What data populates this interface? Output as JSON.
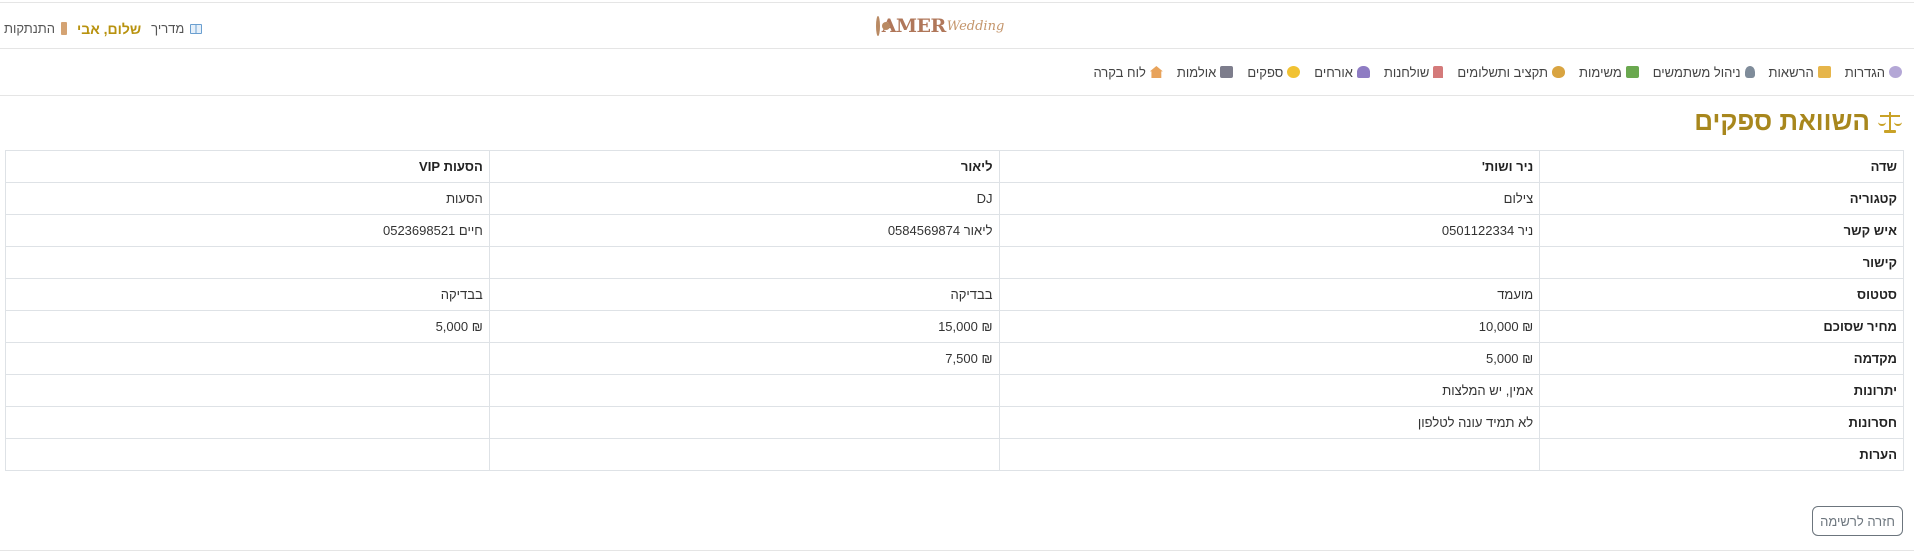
{
  "header": {
    "logo_text": "AMER",
    "logo_script": "Wedding",
    "logout_label": "התנתקות",
    "greeting": "שלום, אבי",
    "guide_label": "מדריך"
  },
  "nav": {
    "items": [
      {
        "label": "לוח בקרה",
        "icon": "home-icon"
      },
      {
        "label": "אולמות",
        "icon": "hall-icon"
      },
      {
        "label": "ספקים",
        "icon": "handshake-icon"
      },
      {
        "label": "אורחים",
        "icon": "people-icon"
      },
      {
        "label": "שולחנות",
        "icon": "chair-icon"
      },
      {
        "label": "תקציב ותשלומים",
        "icon": "money-bag-icon"
      },
      {
        "label": "משימות",
        "icon": "checkmark-icon"
      },
      {
        "label": "ניהול משתמשים",
        "icon": "user-icon"
      },
      {
        "label": "הרשאות",
        "icon": "lock-icon"
      },
      {
        "label": "הגדרות",
        "icon": "gear-icon"
      }
    ]
  },
  "page": {
    "title": "השוואת ספקים",
    "back_button": "חזרה לרשימה"
  },
  "table": {
    "headers": [
      "שדה",
      "ניר ושות'",
      "ליאור",
      "הסעות VIP"
    ],
    "rows": [
      [
        "קטגוריה",
        "צילום",
        "DJ",
        "הסעות"
      ],
      [
        "איש קשר",
        "ניר 0501122334",
        "ליאור 0584569874",
        "חיים 0523698521"
      ],
      [
        "קישור",
        "",
        "",
        ""
      ],
      [
        "סטטוס",
        "מועמד",
        "בבדיקה",
        "בבדיקה"
      ],
      [
        "מחיר שסוכם",
        "₪ 10,000",
        "₪ 15,000",
        "₪ 5,000"
      ],
      [
        "מקדמה",
        "₪ 5,000",
        "₪ 7,500",
        ""
      ],
      [
        "יתרונות",
        "אמין, יש המלצות",
        "",
        ""
      ],
      [
        "חסרונות",
        "לא תמיד עונה לטלפון",
        "",
        ""
      ],
      [
        "הערות",
        "",
        "",
        ""
      ]
    ]
  }
}
